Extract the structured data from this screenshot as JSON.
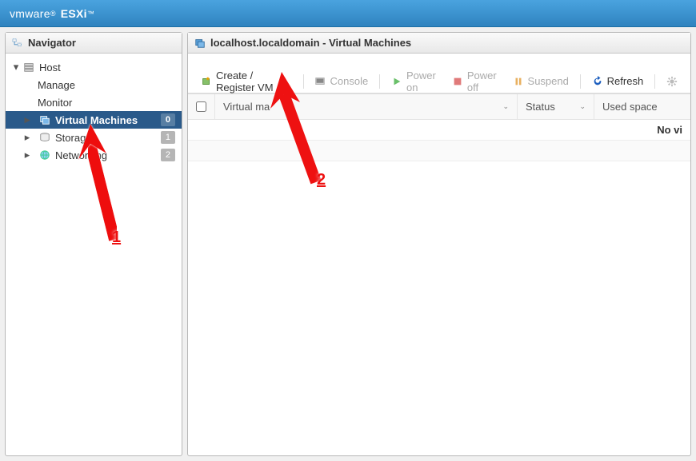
{
  "brand": {
    "vmw": "vmware",
    "esxi": "ESXi"
  },
  "navigator": {
    "title": "Navigator",
    "host": {
      "label": "Host",
      "manage": "Manage",
      "monitor": "Monitor"
    },
    "items": [
      {
        "label": "Virtual Machines",
        "count": "0"
      },
      {
        "label": "Storage",
        "count": "1"
      },
      {
        "label": "Networking",
        "count": "2"
      }
    ]
  },
  "main": {
    "title": "localhost.localdomain - Virtual Machines",
    "toolbar": {
      "create": "Create / Register VM",
      "console": "Console",
      "poweron": "Power on",
      "poweroff": "Power off",
      "suspend": "Suspend",
      "refresh": "Refresh"
    },
    "columns": {
      "name": "Virtual ma",
      "status": "Status",
      "used": "Used space"
    },
    "empty_msg": "No vi"
  },
  "annotations": {
    "a1": "1",
    "a2": "2"
  }
}
